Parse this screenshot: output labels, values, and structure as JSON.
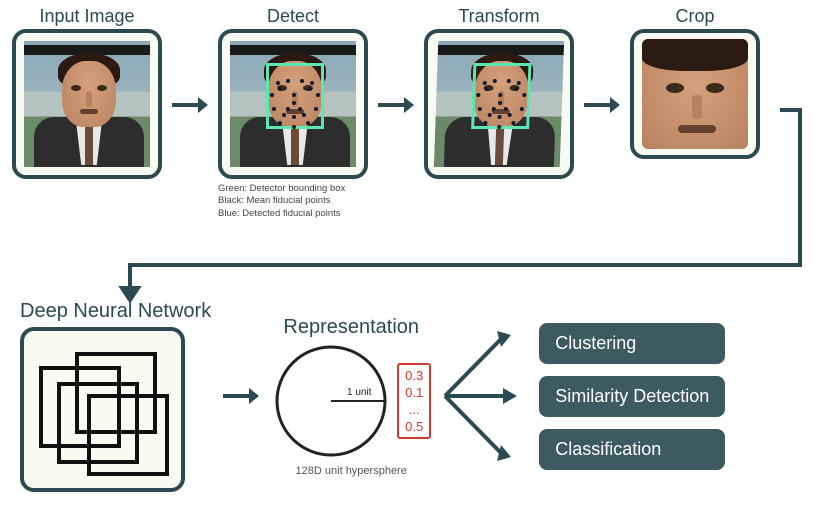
{
  "stages": {
    "input": "Input Image",
    "detect": "Detect",
    "transform": "Transform",
    "crop": "Crop"
  },
  "legend": {
    "green": "Green: Detector bounding box",
    "black": "Black: Mean fiducial points",
    "blue": "Blue: Detected fiducial points"
  },
  "dnn": {
    "title": "Deep Neural Network"
  },
  "representation": {
    "title": "Representation",
    "unit_label": "1 unit",
    "caption": "128D unit hypersphere",
    "vector": [
      "0.3",
      "0.1",
      "...",
      "0.5"
    ]
  },
  "applications": {
    "clustering": "Clustering",
    "similarity": "Similarity Detection",
    "classification": "Classification"
  }
}
